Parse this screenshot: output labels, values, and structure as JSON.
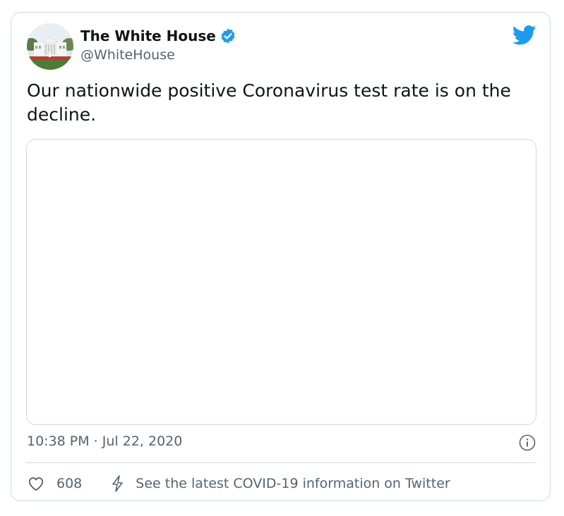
{
  "author": {
    "display_name": "The White House",
    "handle": "@WhiteHouse",
    "verified_icon": "verified-badge-icon",
    "avatar_icon": "white-house-avatar"
  },
  "tweet": {
    "text": "Our nationwide positive Coronavirus test rate is on the decline.",
    "timestamp": "10:38 PM · Jul 22, 2020"
  },
  "actions": {
    "like_count": "608",
    "covid_link": "See the latest COVID-19 information on Twitter"
  },
  "colors": {
    "twitter_blue": "#1d9bf0",
    "text_primary": "#0f1419",
    "text_secondary": "#536471",
    "border": "#cfd9de"
  }
}
